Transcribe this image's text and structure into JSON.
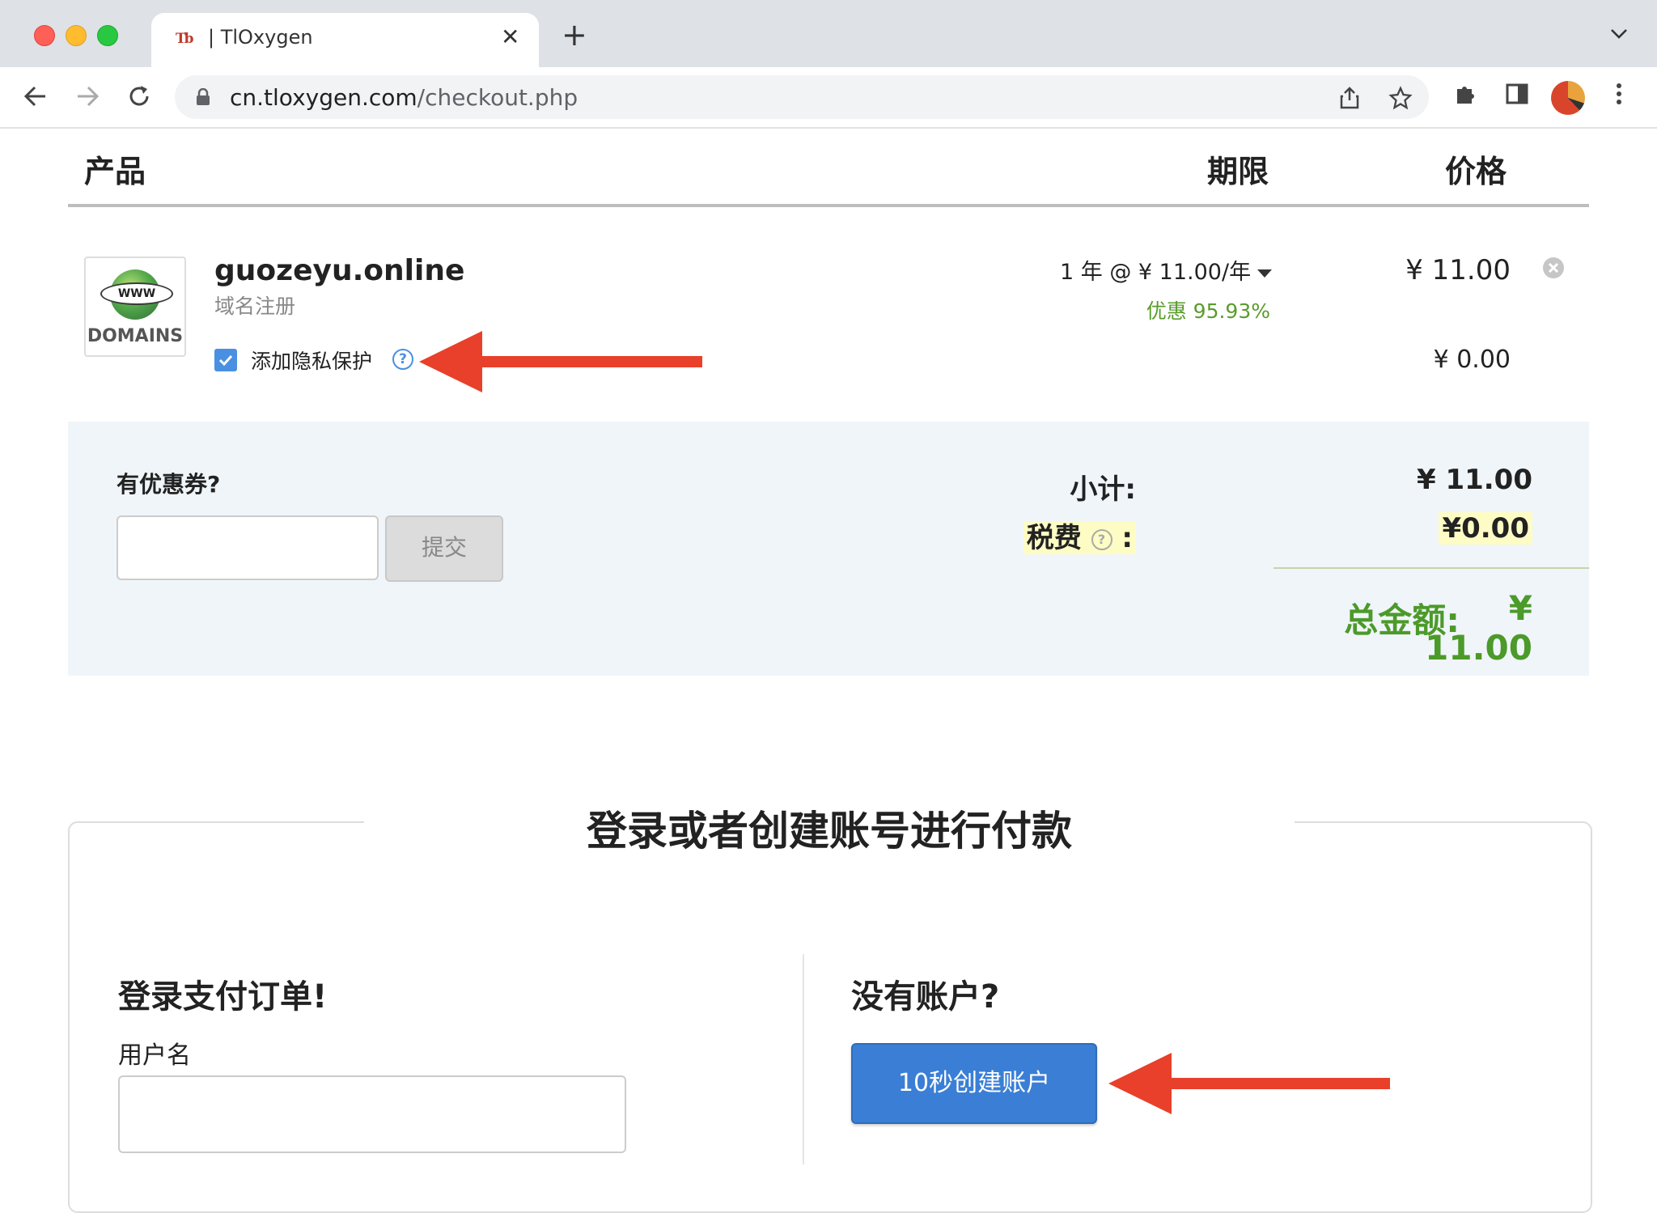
{
  "browser": {
    "tab_title": "| TlOxygen",
    "favicon_text": "Tb",
    "url_domain": "cn.tloxygen.com",
    "url_path": "/checkout.php"
  },
  "table_header": {
    "product": "产品",
    "term": "期限",
    "price": "价格"
  },
  "product": {
    "logo_www": "WWW",
    "logo_text": "DOMAINS",
    "name": "guozeyu.online",
    "type": "域名注册",
    "privacy_label": "添加隐私保护",
    "privacy_checked": true,
    "term": "1 年 @ ¥ 11.00/年",
    "discount": "优惠 95.93%",
    "price": "¥ 11.00",
    "privacy_price": "¥ 0.00"
  },
  "summary": {
    "coupon_question": "有优惠券?",
    "coupon_placeholder": "",
    "coupon_submit": "提交",
    "subtotal_label": "小计:",
    "subtotal_value": "¥ 11.00",
    "tax_label": "税费",
    "tax_colon": ":",
    "tax_value": "¥0.00",
    "total_label": "总金额:",
    "total_value": "¥ 11.00"
  },
  "account": {
    "heading": "登录或者创建账号进行付款",
    "login_title": "登录支付订单!",
    "username_label": "用户名",
    "username_value": "",
    "no_account_title": "没有账户?",
    "create_button": "10秒创建账户"
  },
  "colors": {
    "accent_blue": "#3a7fd5",
    "total_green": "#4c9a2a",
    "arrow_red": "#e8402a"
  }
}
